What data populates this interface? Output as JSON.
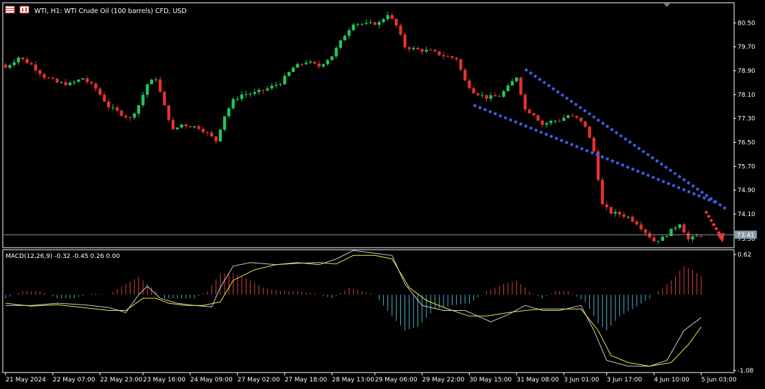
{
  "header": {
    "title": "WTI, H1:  WTI Crude Oil (100 barrels) CFD, USD",
    "icons": [
      "symbol-table-icon",
      "chart-type-icon"
    ]
  },
  "colors": {
    "background": "#000000",
    "frame": "#ffffff",
    "bull": "#22c55e",
    "bear": "#e5322d",
    "trendline": "#3b5ee8",
    "arrow": "#e83a3a",
    "macd_line": "#cfcfcf",
    "signal_line": "#f2e84a",
    "hist_pos": "#e04040",
    "hist_neg": "#4ab4d0",
    "price_line": "#8a9aa8"
  },
  "chart_data": [
    {
      "type": "candlestick",
      "title": "WTI, H1:  WTI Crude Oil (100 barrels) CFD, USD",
      "ylim": [
        73.0,
        81.15
      ],
      "y_ticks": [
        "80.50",
        "79.70",
        "78.90",
        "78.10",
        "77.30",
        "76.50",
        "75.70",
        "74.90",
        "74.10"
      ],
      "current_price": "73.41",
      "current_price_under": "73.30",
      "x_tick_labels": [
        "21 May 2024",
        "22 May 07:00",
        "22 May 23:00",
        "23 May 16:00",
        "24 May 09:00",
        "27 May 02:00",
        "27 May 18:00",
        "28 May 13:00",
        "29 May 06:00",
        "29 May 22:00",
        "30 May 15:00",
        "31 May 08:00",
        "3 Jun 01:00",
        "3 Jun 17:00",
        "4 Jun 10:00",
        "5 Jun 03:00"
      ],
      "close_path": [
        [
          0,
          79.0
        ],
        [
          3,
          79.35
        ],
        [
          6,
          79.1
        ],
        [
          9,
          78.7
        ],
        [
          12,
          78.5
        ],
        [
          15,
          78.45
        ],
        [
          18,
          78.65
        ],
        [
          21,
          78.3
        ],
        [
          24,
          77.7
        ],
        [
          27,
          77.45
        ],
        [
          29,
          77.3
        ],
        [
          31,
          77.75
        ],
        [
          33,
          78.45
        ],
        [
          35,
          78.65
        ],
        [
          37,
          77.7
        ],
        [
          39,
          76.9
        ],
        [
          41,
          77.1
        ],
        [
          43,
          77.05
        ],
        [
          45,
          77.0
        ],
        [
          47,
          76.8
        ],
        [
          49,
          76.55
        ],
        [
          51,
          77.4
        ],
        [
          53,
          77.9
        ],
        [
          55,
          78.1
        ],
        [
          58,
          78.15
        ],
        [
          61,
          78.3
        ],
        [
          64,
          78.5
        ],
        [
          67,
          79.0
        ],
        [
          70,
          79.2
        ],
        [
          73,
          79.05
        ],
        [
          76,
          79.4
        ],
        [
          79,
          80.1
        ],
        [
          81,
          80.5
        ],
        [
          84,
          80.45
        ],
        [
          87,
          80.5
        ],
        [
          89,
          80.8
        ],
        [
          91,
          80.4
        ],
        [
          93,
          79.7
        ],
        [
          96,
          79.6
        ],
        [
          99,
          79.55
        ],
        [
          102,
          79.4
        ],
        [
          105,
          79.3
        ],
        [
          107,
          78.55
        ],
        [
          109,
          78.2
        ],
        [
          112,
          78.0
        ],
        [
          115,
          78.05
        ],
        [
          117,
          78.35
        ],
        [
          119,
          78.7
        ],
        [
          121,
          77.6
        ],
        [
          123,
          77.45
        ],
        [
          125,
          77.1
        ],
        [
          127,
          77.2
        ],
        [
          129,
          77.25
        ],
        [
          131,
          77.4
        ],
        [
          133,
          77.3
        ],
        [
          135,
          77.05
        ],
        [
          137,
          76.2
        ],
        [
          139,
          74.4
        ],
        [
          141,
          74.15
        ],
        [
          143,
          74.1
        ],
        [
          145,
          74.0
        ],
        [
          147,
          73.8
        ],
        [
          149,
          73.5
        ],
        [
          151,
          73.2
        ],
        [
          153,
          73.3
        ],
        [
          155,
          73.55
        ],
        [
          157,
          73.8
        ],
        [
          159,
          73.25
        ],
        [
          161,
          73.35
        ],
        [
          162,
          73.41
        ]
      ],
      "annotations": {
        "upper_trendline": {
          "from": [
            121,
            78.95
          ],
          "to": [
            168,
            74.25
          ]
        },
        "lower_trendline": {
          "from": [
            109,
            77.75
          ],
          "to": [
            166,
            74.45
          ]
        },
        "forecast_arrow": {
          "from": [
            163,
            74.2
          ],
          "to": [
            167,
            73.15
          ]
        }
      }
    },
    {
      "type": "macd",
      "label": "MACD(12,26,9) -0.32 -0.45 0.26 0.00",
      "ylim": [
        -1.08,
        0.62
      ],
      "y_ticks": [
        "0.62",
        "-1.08"
      ],
      "macd_path": [
        [
          0,
          -0.15
        ],
        [
          6,
          -0.15
        ],
        [
          12,
          -0.12
        ],
        [
          18,
          -0.14
        ],
        [
          24,
          -0.18
        ],
        [
          28,
          -0.25
        ],
        [
          31,
          0.0
        ],
        [
          33,
          0.12
        ],
        [
          36,
          -0.05
        ],
        [
          40,
          -0.12
        ],
        [
          44,
          -0.15
        ],
        [
          48,
          -0.17
        ],
        [
          50,
          0.1
        ],
        [
          53,
          0.4
        ],
        [
          57,
          0.45
        ],
        [
          63,
          0.42
        ],
        [
          68,
          0.45
        ],
        [
          73,
          0.42
        ],
        [
          77,
          0.5
        ],
        [
          81,
          0.62
        ],
        [
          86,
          0.58
        ],
        [
          90,
          0.55
        ],
        [
          93,
          0.15
        ],
        [
          97,
          -0.15
        ],
        [
          102,
          -0.22
        ],
        [
          107,
          -0.22
        ],
        [
          110,
          -0.3
        ],
        [
          113,
          -0.38
        ],
        [
          117,
          -0.28
        ],
        [
          121,
          -0.15
        ],
        [
          125,
          -0.22
        ],
        [
          129,
          -0.22
        ],
        [
          134,
          -0.15
        ],
        [
          137,
          -0.5
        ],
        [
          140,
          -0.92
        ],
        [
          145,
          -1.0
        ],
        [
          150,
          -1.0
        ],
        [
          154,
          -0.92
        ],
        [
          158,
          -0.5
        ],
        [
          162,
          -0.32
        ]
      ],
      "signal_path": [
        [
          0,
          -0.12
        ],
        [
          6,
          -0.16
        ],
        [
          12,
          -0.14
        ],
        [
          18,
          -0.18
        ],
        [
          24,
          -0.22
        ],
        [
          28,
          -0.22
        ],
        [
          32,
          -0.05
        ],
        [
          35,
          -0.05
        ],
        [
          38,
          -0.12
        ],
        [
          42,
          -0.15
        ],
        [
          46,
          -0.15
        ],
        [
          50,
          -0.1
        ],
        [
          53,
          0.2
        ],
        [
          58,
          0.35
        ],
        [
          63,
          0.42
        ],
        [
          68,
          0.44
        ],
        [
          73,
          0.45
        ],
        [
          77,
          0.43
        ],
        [
          81,
          0.55
        ],
        [
          86,
          0.55
        ],
        [
          90,
          0.5
        ],
        [
          94,
          0.1
        ],
        [
          98,
          -0.08
        ],
        [
          103,
          -0.2
        ],
        [
          108,
          -0.3
        ],
        [
          112,
          -0.3
        ],
        [
          117,
          -0.25
        ],
        [
          121,
          -0.22
        ],
        [
          125,
          -0.2
        ],
        [
          129,
          -0.2
        ],
        [
          134,
          -0.2
        ],
        [
          138,
          -0.5
        ],
        [
          141,
          -0.85
        ],
        [
          145,
          -0.95
        ],
        [
          150,
          -1.0
        ],
        [
          155,
          -0.95
        ],
        [
          159,
          -0.7
        ],
        [
          162,
          -0.45
        ]
      ],
      "histogram_path": [
        [
          0,
          -0.05
        ],
        [
          4,
          0.05
        ],
        [
          8,
          0.05
        ],
        [
          12,
          -0.05
        ],
        [
          16,
          -0.05
        ],
        [
          20,
          0.02
        ],
        [
          24,
          0.0
        ],
        [
          28,
          0.15
        ],
        [
          31,
          0.25
        ],
        [
          34,
          0.1
        ],
        [
          37,
          -0.05
        ],
        [
          40,
          -0.05
        ],
        [
          44,
          -0.05
        ],
        [
          47,
          0.05
        ],
        [
          50,
          0.3
        ],
        [
          53,
          0.3
        ],
        [
          57,
          0.2
        ],
        [
          60,
          0.1
        ],
        [
          64,
          0.05
        ],
        [
          68,
          0.05
        ],
        [
          72,
          0.02
        ],
        [
          76,
          -0.05
        ],
        [
          80,
          0.1
        ],
        [
          83,
          0.05
        ],
        [
          86,
          0.0
        ],
        [
          90,
          -0.3
        ],
        [
          93,
          -0.5
        ],
        [
          96,
          -0.45
        ],
        [
          100,
          -0.2
        ],
        [
          104,
          -0.15
        ],
        [
          108,
          -0.12
        ],
        [
          112,
          0.05
        ],
        [
          116,
          0.15
        ],
        [
          119,
          0.2
        ],
        [
          122,
          0.05
        ],
        [
          125,
          -0.05
        ],
        [
          128,
          0.05
        ],
        [
          131,
          0.05
        ],
        [
          135,
          -0.1
        ],
        [
          138,
          -0.4
        ],
        [
          140,
          -0.5
        ],
        [
          143,
          -0.3
        ],
        [
          146,
          -0.2
        ],
        [
          150,
          -0.05
        ],
        [
          152,
          0.05
        ],
        [
          155,
          0.2
        ],
        [
          158,
          0.4
        ],
        [
          160,
          0.35
        ],
        [
          162,
          0.26
        ]
      ]
    }
  ]
}
